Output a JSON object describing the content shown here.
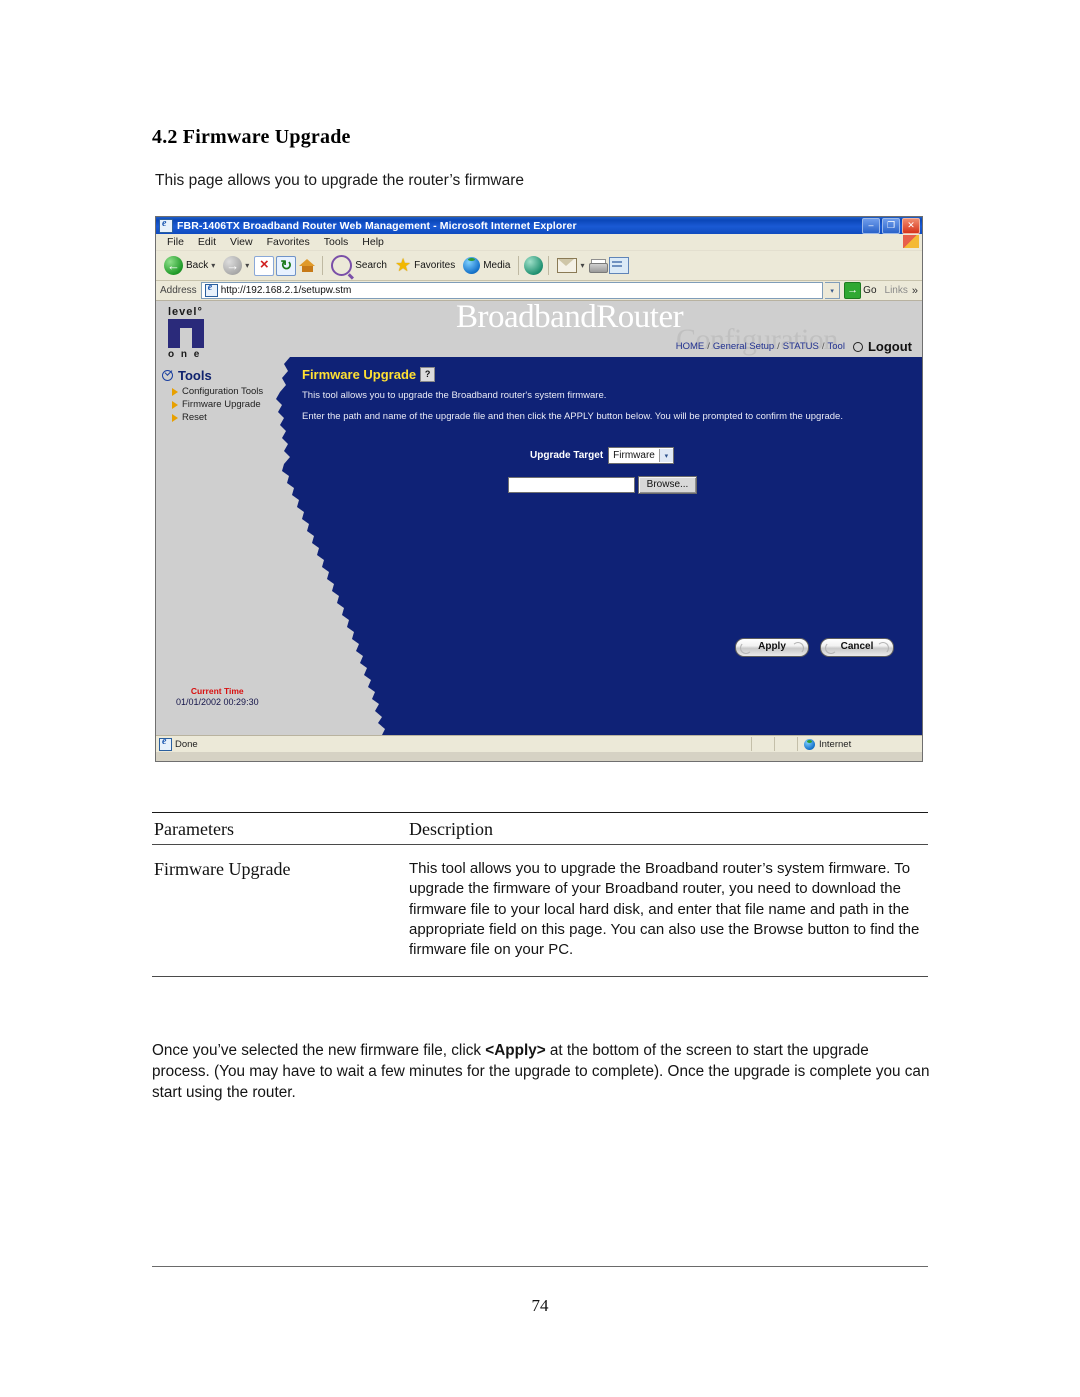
{
  "document": {
    "section_heading": "4.2 Firmware Upgrade",
    "intro": "This page allows you to upgrade the router’s firmware",
    "page_number": "74",
    "closing_part1": "Once you’ve selected the new firmware file, click ",
    "closing_apply": "<Apply>",
    "closing_part2": " at the bottom of the screen to start the upgrade process. (You may have to wait a few minutes for the upgrade to complete). Once the upgrade is complete you can start using the router."
  },
  "params_table": {
    "headers": [
      "Parameters",
      "Description"
    ],
    "rows": [
      {
        "parameter": "Firmware Upgrade",
        "description": "This tool allows you to upgrade the Broadband router’s system firmware. To upgrade the firmware of your Broadband router, you need to download the firmware file to your local hard disk, and enter that file name and path in the appropriate field on this page. You can also use the Browse button to find the firmware file on your PC."
      }
    ]
  },
  "browser": {
    "title": "FBR-1406TX Broadband Router Web Management - Microsoft Internet Explorer",
    "window_buttons": {
      "minimize": "–",
      "maximize": "❐",
      "close": "✕"
    },
    "menu": [
      "File",
      "Edit",
      "View",
      "Favorites",
      "Tools",
      "Help"
    ],
    "toolbar": {
      "back": "Back",
      "back_caret": "▾",
      "forward_caret": "▾",
      "search": "Search",
      "favorites": "Favorites",
      "media": "Media",
      "mail_caret": "▾"
    },
    "address": {
      "label": "Address",
      "value": "http://192.168.2.1/setupw.stm",
      "dropdown_caret": "▾",
      "go": "Go",
      "links": "Links",
      "links_chevron": "»"
    },
    "status": {
      "text": "Done",
      "zone": "Internet"
    }
  },
  "router_ui": {
    "logo": {
      "word": "level°",
      "sub": "o n e"
    },
    "brand": "BroadbandRouter",
    "brand_sub": "Configuration",
    "nav": {
      "items": [
        "HOME",
        "General Setup",
        "STATUS",
        "Tool"
      ],
      "separator": "/",
      "logout": "Logout"
    },
    "sidebar": {
      "title": "Tools",
      "items": [
        "Configuration Tools",
        "Firmware Upgrade",
        "Reset"
      ]
    },
    "content": {
      "title": "Firmware Upgrade",
      "help_icon_label": "?",
      "paragraph1": "This tool allows you to upgrade the Broadband router's system firmware.",
      "paragraph2": "Enter the path and name of the upgrade file and then click the APPLY button below. You will be prompted to confirm the upgrade.",
      "upgrade_target_label": "Upgrade Target",
      "upgrade_target_value": "Firmware",
      "select_caret": "▾",
      "file_input_value": "",
      "browse_button": "Browse...",
      "apply_button": "Apply",
      "cancel_button": "Cancel",
      "current_time_label": "Current Time",
      "current_time_value": "01/01/2002 00:29:30"
    },
    "colors": {
      "navy": "#0f2276",
      "yellow": "#ffe033",
      "grey": "#cfcfcf",
      "red": "#d81010"
    }
  }
}
